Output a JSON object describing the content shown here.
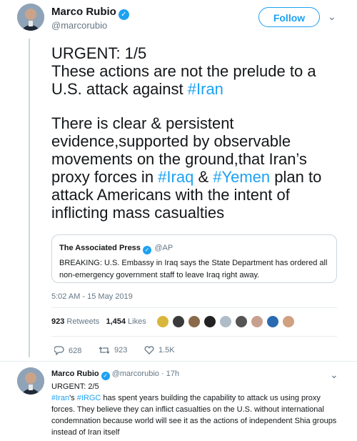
{
  "tweet": {
    "author_name": "Marco Rubio",
    "author_handle": "@marcorubio",
    "follow_label": "Follow",
    "chevron": "chevron-down-icon",
    "text_line1": "URGENT: 1/5",
    "text_line2": "These actions are not the prelude to a",
    "text_line3a": "U.S. attack against ",
    "text_line3_hashtag": "#Iran",
    "para2_line1": "There is clear & persistent",
    "para2_line2": "evidence,supported by observable",
    "para2_line3": "movements on the ground,that Iran’s",
    "para2_line4a": "proxy forces in ",
    "para2_line4_hashtag1": "#Iraq",
    "para2_line4_amp": " & ",
    "para2_line4_hashtag2": "#Yemen",
    "para2_line4b": " plan to",
    "para2_line5": "attack Americans with the intent of",
    "para2_line6": "inflicting mass casualties",
    "quote": {
      "name": "The Associated Press",
      "handle": "@AP",
      "text": "BREAKING: U.S. Embassy in Iraq says the State Department has ordered all non-emergency government staff to leave Iraq right away."
    },
    "timestamp": "5:02 AM - 15 May 2019",
    "retweets_count": "923",
    "retweets_label": "Retweets",
    "likes_count": "1,454",
    "likes_label": "Likes",
    "reply_count": "628",
    "retweet_action_count": "923",
    "like_action_count": "1.5K"
  },
  "reply": {
    "author_name": "Marco Rubio",
    "author_handle": "@marcorubio",
    "time": "· 17h",
    "line1": "URGENT: 2/5",
    "hashtag1": "#Iran",
    "mid1": "'s ",
    "hashtag2": "#IRGC",
    "rest": " has spent years building the capability to attack us using proxy forces. They believe they can inflict casualties on the U.S. without international condemnation because world will see it as the actions of independent Shia groups instead of Iran itself"
  },
  "colors": {
    "accent": "#1da1f2",
    "muted": "#657786",
    "border": "#ccd6dd"
  }
}
